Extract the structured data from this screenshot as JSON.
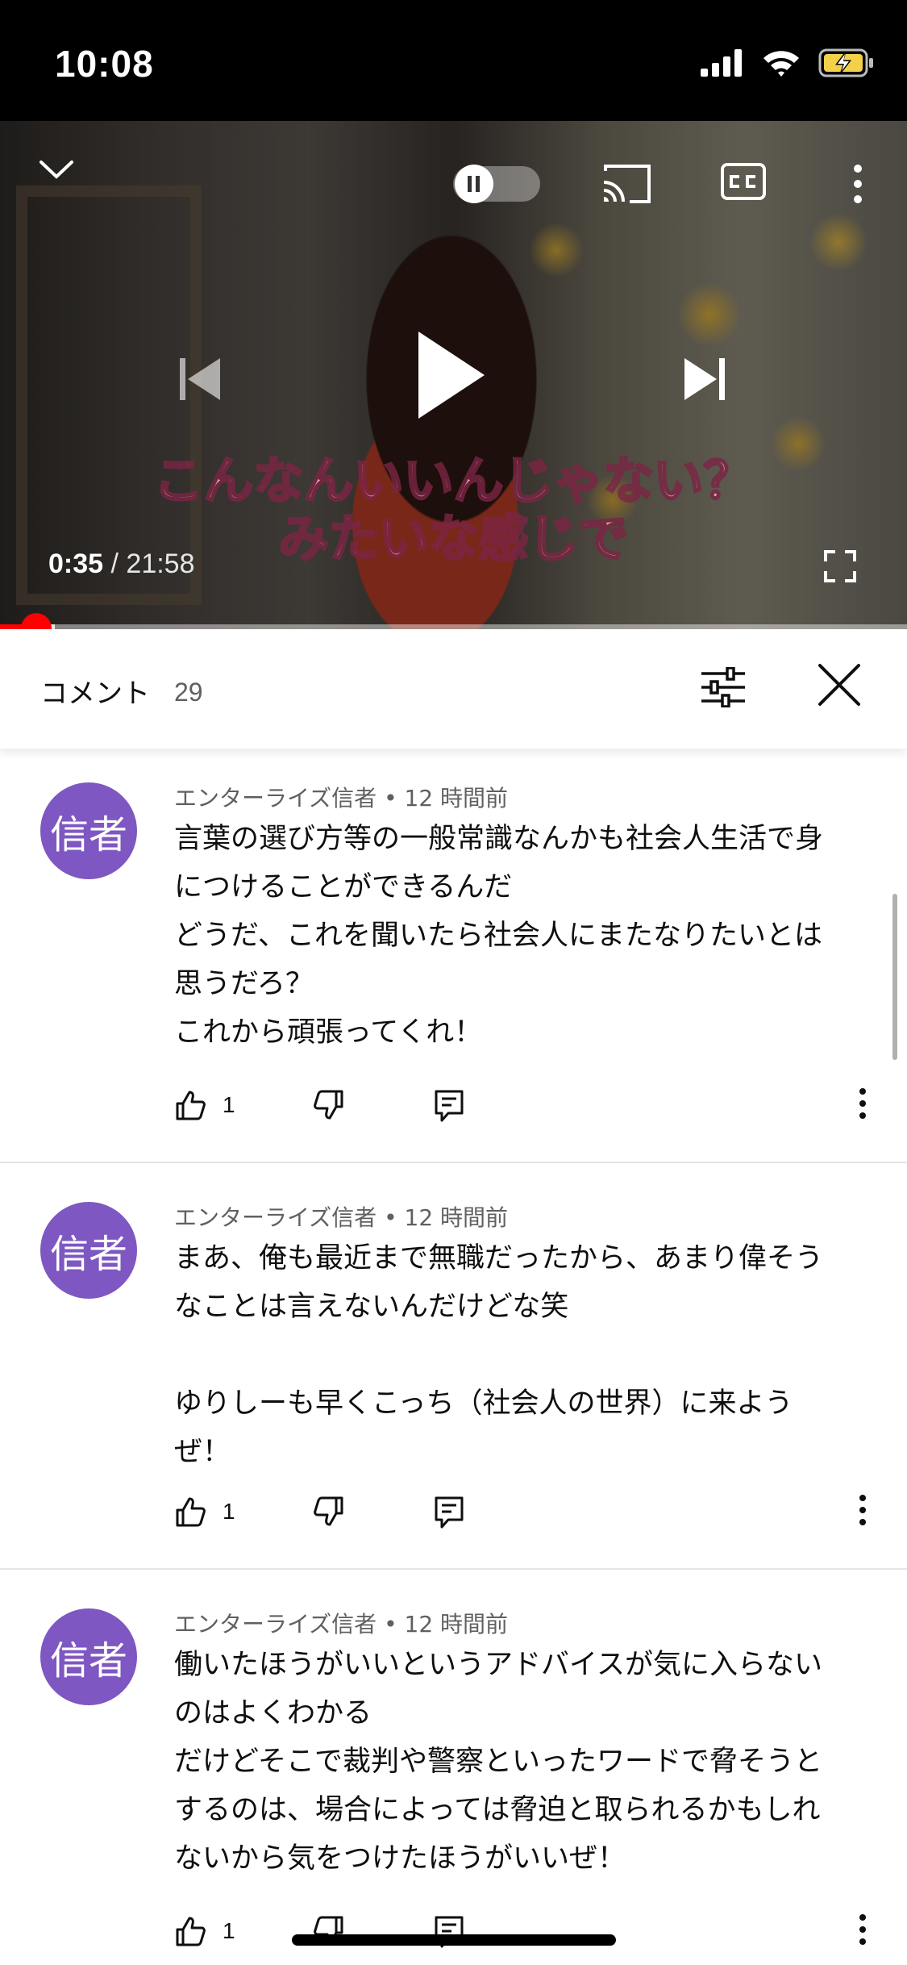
{
  "status_bar": {
    "time": "10:08",
    "icons": [
      "signal-icon",
      "wifi-icon",
      "battery-charging-icon"
    ]
  },
  "player": {
    "subtitle_line1": "こんなんいいんじゃない？",
    "subtitle_line2": "みたいな感じで",
    "current_time": "0:35",
    "separator": " / ",
    "total_time": "21:58",
    "progress": 0.027,
    "accent_color": "#ff0000"
  },
  "comments_header": {
    "title": "コメント",
    "count": "29"
  },
  "comments": [
    {
      "avatar_text": "信者",
      "author": "エンターライズ信者",
      "dot": " • ",
      "time": "12 時間前",
      "text": "言葉の選び方等の一般常識なんかも社会人生活で身\nにつけることができるんだ\nどうだ、これを聞いたら社会人にまたなりたいとは\n思うだろ？\nこれから頑張ってくれ！",
      "likes": "1"
    },
    {
      "avatar_text": "信者",
      "author": "エンターライズ信者",
      "dot": " • ",
      "time": "12 時間前",
      "text": "まあ、俺も最近まで無職だったから、あまり偉そう\nなことは言えないんだけどな笑\n\nゆりしーも早くこっち（社会人の世界）に来よう\nぜ！",
      "likes": "1"
    },
    {
      "avatar_text": "信者",
      "author": "エンターライズ信者",
      "dot": " • ",
      "time": "12 時間前",
      "text": "働いたほうがいいというアドバイスが気に入らない\nのはよくわかる\nだけどそこで裁判や警察といったワードで脅そうと\nするのは、場合によっては脅迫と取られるかもしれ\nないから気をつけたほうがいいぜ！",
      "likes": "1"
    }
  ]
}
